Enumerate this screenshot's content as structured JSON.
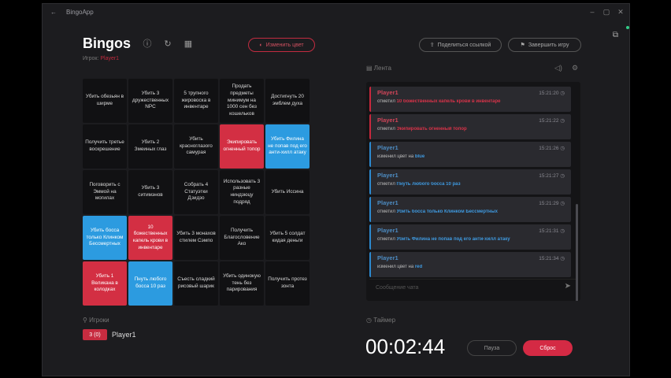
{
  "window": {
    "title": "BingoApp"
  },
  "header": {
    "title": "Bingos",
    "color_button": "Изменить цвет",
    "share_button": "Поделиться ссылкой",
    "finish_button": "Завершить игру"
  },
  "subtitle": {
    "prefix": "Игрок:",
    "player": "Player1"
  },
  "board": {
    "cells": [
      {
        "text": "Убить обезьян в ширме",
        "state": "none"
      },
      {
        "text": "Убить 3 дружественных NPC",
        "state": "none"
      },
      {
        "text": "5 трупного жировоска в инвентаре",
        "state": "none"
      },
      {
        "text": "Продать предметы минимум на 1000 сен без кошельков",
        "state": "none"
      },
      {
        "text": "Достигнуть 20 эмблем духа",
        "state": "none"
      },
      {
        "text": "Получить третье воскрешение",
        "state": "none"
      },
      {
        "text": "Убить 2 Змеиных глаз",
        "state": "none"
      },
      {
        "text": "Убить красноглазого самурая",
        "state": "none"
      },
      {
        "text": "Экипировать огненный топор",
        "state": "red"
      },
      {
        "text": "Убить Филина не попав под его анти-хилл атаку",
        "state": "blue"
      },
      {
        "text": "Поговорить с Эммой на могилах",
        "state": "none"
      },
      {
        "text": "Убить 3 ситимэнов",
        "state": "none"
      },
      {
        "text": "Собрать 4 Статуэтки Дзидзо",
        "state": "none"
      },
      {
        "text": "Использовать 3 разные ниндзюцу подряд",
        "state": "none"
      },
      {
        "text": "Убить Иссина",
        "state": "none"
      },
      {
        "text": "Убить босса только Клинком Бессмертных",
        "state": "blue"
      },
      {
        "text": "10 божественных капель крови в инвентаре",
        "state": "red"
      },
      {
        "text": "Убить 3 монахов стилем Сэмпо",
        "state": "none"
      },
      {
        "text": "Получить Благословение Ако",
        "state": "none"
      },
      {
        "text": "Убить 5 солдат кидая деньги",
        "state": "none"
      },
      {
        "text": "Убить 1 Великана в колодках",
        "state": "red"
      },
      {
        "text": "Пнуть любого босса 10 раз",
        "state": "blue"
      },
      {
        "text": "Съесть сладкий рисовый шарик",
        "state": "none"
      },
      {
        "text": "Убить одинокую тень без парирования",
        "state": "none"
      },
      {
        "text": "Получить протез зонта",
        "state": "none"
      }
    ]
  },
  "players": {
    "heading": "Игроки",
    "list": [
      {
        "badge": "3 (0)",
        "name": "Player1"
      }
    ]
  },
  "feed": {
    "heading": "Лента",
    "chat_placeholder": "Сообщение чата",
    "entries": [
      {
        "player": "Player1",
        "time": "15:21:20",
        "action": "отметил",
        "item": "10 божественных капель крови в инвентаре",
        "color": "red"
      },
      {
        "player": "Player1",
        "time": "15:21:22",
        "action": "отметил",
        "item": "Экипировать огненный топор",
        "color": "red"
      },
      {
        "player": "Player1",
        "time": "15:21:26",
        "action": "изменил цвет на",
        "item": "blue",
        "color": "blue"
      },
      {
        "player": "Player1",
        "time": "15:21:27",
        "action": "отметил",
        "item": "Пнуть любого босса 10 раз",
        "color": "blue"
      },
      {
        "player": "Player1",
        "time": "15:21:29",
        "action": "отметил",
        "item": "Убить босса только Клинком Бессмертных",
        "color": "blue"
      },
      {
        "player": "Player1",
        "time": "15:21:31",
        "action": "отметил",
        "item": "Убить Филина не попав под его анти-хилл атаку",
        "color": "blue"
      },
      {
        "player": "Player1",
        "time": "15:21:34",
        "action": "изменил цвет на",
        "item": "red",
        "color": "blue"
      }
    ]
  },
  "timer": {
    "heading": "Таймер",
    "value": "00:02:44",
    "pause": "Пауза",
    "reset": "Сброс"
  },
  "colors": {
    "red": "#d32f43",
    "blue": "#2c9be0",
    "bg": "#1c1c1f"
  }
}
